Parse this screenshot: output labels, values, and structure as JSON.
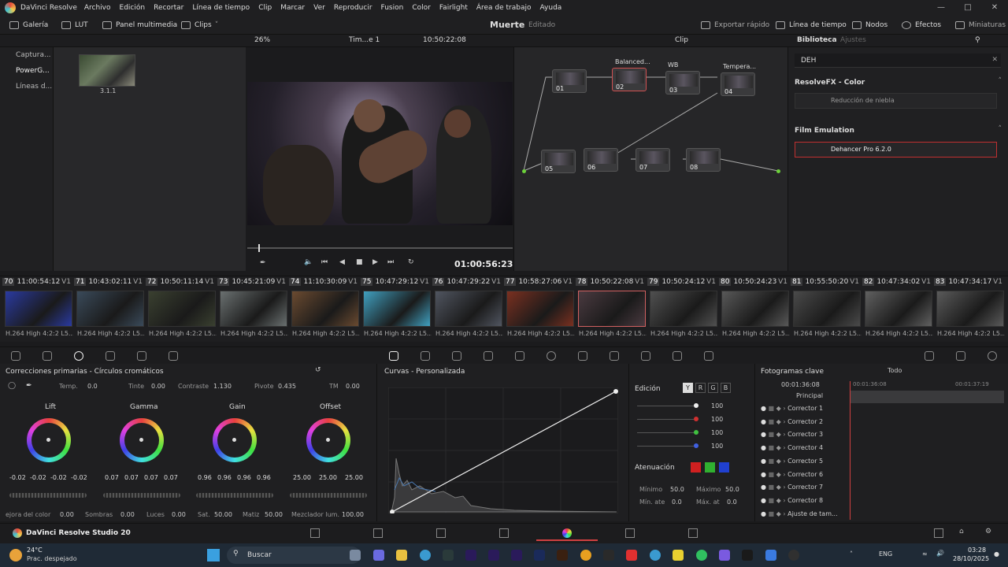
{
  "menu": {
    "app": "DaVinci Resolve",
    "items": [
      "Archivo",
      "Edición",
      "Recortar",
      "Línea de tiempo",
      "Clip",
      "Marcar",
      "Ver",
      "Reproducir",
      "Fusion",
      "Color",
      "Fairlight",
      "Área de trabajo",
      "Ayuda"
    ]
  },
  "toolbar": {
    "gallery": "Galería",
    "lut": "LUT",
    "media": "Panel multimedia",
    "clips": "Clips",
    "project": "Muerte",
    "status": "Editado",
    "quick_export": "Exportar rápido",
    "timeline": "Línea de tiempo",
    "nodes": "Nodos",
    "effects": "Efectos",
    "thumbs": "Miniaturas"
  },
  "viewerbar": {
    "zoom": "26%",
    "timeline": "Tim...e 1",
    "timecode": "10:50:22:08",
    "clip": "Clip",
    "library": "Biblioteca",
    "settings": "Ajustes"
  },
  "leftpanel": {
    "items": [
      "Captura...",
      "PowerG...",
      "Líneas d..."
    ]
  },
  "gallery": {
    "still_label": "3.1.1"
  },
  "viewer": {
    "timecode": "01:00:56:23"
  },
  "nodes": {
    "titles": [
      "Balanced...",
      "WB",
      "Tempera..."
    ],
    "labels": [
      "01",
      "02",
      "03",
      "04",
      "05",
      "06",
      "07",
      "08"
    ]
  },
  "library": {
    "search": "DEH",
    "section1": "ResolveFX - Color",
    "item1": "Reducción de niebla",
    "section2": "Film Emulation",
    "item2": "Dehancer Pro 6.2.0"
  },
  "clips": [
    {
      "num": "70",
      "tc": "11:00:54:12",
      "track": "V1",
      "cap": "H.264 High 4:2:2 L5..."
    },
    {
      "num": "71",
      "tc": "10:43:02:11",
      "track": "V1",
      "cap": "H.264 High 4:2:2 L5..."
    },
    {
      "num": "72",
      "tc": "10:50:11:14",
      "track": "V1",
      "cap": "H.264 High 4:2:2 L5..."
    },
    {
      "num": "73",
      "tc": "10:45:21:09",
      "track": "V1",
      "cap": "H.264 High 4:2:2 L5..."
    },
    {
      "num": "74",
      "tc": "11:10:30:09",
      "track": "V1",
      "cap": "H.264 High 4:2:2 L5..."
    },
    {
      "num": "75",
      "tc": "10:47:29:12",
      "track": "V1",
      "cap": "H.264 High 4:2:2 L5..."
    },
    {
      "num": "76",
      "tc": "10:47:29:22",
      "track": "V1",
      "cap": "H.264 High 4:2:2 L5..."
    },
    {
      "num": "77",
      "tc": "10:58:27:06",
      "track": "V1",
      "cap": "H.264 High 4:2:2 L5..."
    },
    {
      "num": "78",
      "tc": "10:50:22:08",
      "track": "V1",
      "cap": "H.264 High 4:2:2 L5..."
    },
    {
      "num": "79",
      "tc": "10:50:24:12",
      "track": "V1",
      "cap": "H.264 High 4:2:2 L5..."
    },
    {
      "num": "80",
      "tc": "10:50:24:23",
      "track": "V1",
      "cap": "H.264 High 4:2:2 L5..."
    },
    {
      "num": "81",
      "tc": "10:55:50:20",
      "track": "V1",
      "cap": "H.264 High 4:2:2 L5..."
    },
    {
      "num": "82",
      "tc": "10:47:34:02",
      "track": "V1",
      "cap": "H.264 High 4:2:2 L5..."
    },
    {
      "num": "83",
      "tc": "10:47:34:17",
      "track": "V1",
      "cap": "H.264 High 4:2:2 L5..."
    }
  ],
  "primaries": {
    "title": "Correcciones primarias - Círculos cromáticos",
    "temp_l": "Temp.",
    "temp": "0.0",
    "tint_l": "Tinte",
    "tint": "0.00",
    "contrast_l": "Contraste",
    "contrast": "1.130",
    "pivot_l": "Pivote",
    "pivot": "0.435",
    "tm_l": "TM",
    "tm": "0.00",
    "lift": "Lift",
    "lift_v": [
      "-0.02",
      "-0.02",
      "-0.02",
      "-0.02"
    ],
    "gamma": "Gamma",
    "gamma_v": [
      "0.07",
      "0.07",
      "0.07",
      "0.07"
    ],
    "gain": "Gain",
    "gain_v": [
      "0.96",
      "0.96",
      "0.96",
      "0.96"
    ],
    "offset": "Offset",
    "offset_v": [
      "25.00",
      "25.00",
      "25.00"
    ],
    "boost_l": "ejora del color",
    "boost": "0.00",
    "shadows_l": "Sombras",
    "shadows": "0.00",
    "lights_l": "Luces",
    "lights": "0.00",
    "sat_l": "Sat.",
    "sat": "50.00",
    "hue_l": "Matiz",
    "hue": "50.00",
    "lum_l": "Mezclador lum.",
    "lum": "100.00"
  },
  "curves": {
    "title": "Curvas - Personalizada",
    "edit": "Edición",
    "vals": [
      "100",
      "100",
      "100",
      "100"
    ],
    "att": "Atenuación",
    "min_l": "Mínimo",
    "min": "50.0",
    "max_l": "Máximo",
    "max": "50.0",
    "minatt_l": "Mín. ate",
    "minatt": "0.0",
    "maxatt_l": "Máx. at",
    "maxatt": "0.0"
  },
  "keyframes": {
    "title": "Fotogramas clave",
    "filter": "Todo",
    "tc1": "00:01:36:08",
    "tc2": "00:01:36:08",
    "tc3": "00:01:37:19",
    "main": "Principal",
    "rows": [
      "Corrector 1",
      "Corrector 2",
      "Corrector 3",
      "Corrector 4",
      "Corrector 5",
      "Corrector 6",
      "Corrector 7",
      "Corrector 8",
      "Ajuste de tam..."
    ]
  },
  "footer": {
    "app": "DaVinci Resolve Studio 20"
  },
  "taskbar": {
    "temp": "24°C",
    "weather": "Prac. despejado",
    "search": "Buscar",
    "lang": "ENG",
    "time": "03:28",
    "date": "28/10/2025"
  },
  "colors": {
    "accent": "#d04040",
    "node_green": "#6cd23a",
    "node_blue": "#3aa0e0"
  }
}
